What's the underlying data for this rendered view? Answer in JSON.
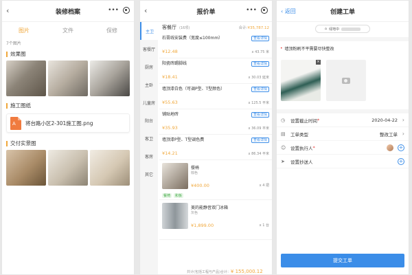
{
  "panel1": {
    "title": "装修档案",
    "tabs": [
      "图片",
      "文件",
      "保修"
    ],
    "count": "7个图片",
    "sections": {
      "effect": "效果图",
      "construction": "施工图纸",
      "delivery": "交付实景图"
    },
    "file": {
      "icon_label": "A",
      "name": "将台路小区2-301施工图.png"
    }
  },
  "panel2": {
    "title": "报价单",
    "sidebar": [
      "主卫",
      "客餐厅",
      "厨房",
      "主卧",
      "儿童房",
      "阳台",
      "客卫",
      "客房",
      "其它"
    ],
    "room": {
      "name": "客餐厅",
      "count": "(16项)",
      "total_label": "合计:",
      "total_value": "¥35,787.12"
    },
    "items": [
      {
        "name": "石膏线安装费（宽度≤100mm）",
        "price": "¥12.48",
        "qty": "x 43.75 米",
        "detail": "查看详情"
      },
      {
        "name": "阳瓷砖踢脚线",
        "price": "¥18.41",
        "qty": "x 30.03 延米",
        "detail": "查看详情"
      },
      {
        "name": "墙顶漆白色（可调P型、T型颜色）",
        "price": "¥55.63",
        "qty": "x 125.5 平米",
        "detail": "查看详情"
      },
      {
        "name": "铺贴地砖",
        "price": "¥35.93",
        "qty": "x 36.09 平米",
        "detail": "查看详情"
      },
      {
        "name": "墙顶漆P型、T型调色费",
        "price": "¥14.21",
        "qty": "x 86.34 平米",
        "detail": "查看详情"
      }
    ],
    "products": [
      {
        "name": "餐椅",
        "spec": "棕色",
        "price": "¥400.00",
        "qty": "x 4 把",
        "tags": [
          "餐椅",
          "和板"
        ]
      },
      {
        "name": "美的能静音双门冰箱",
        "spec": "灰色",
        "price": "¥1,899.00",
        "qty": "x 1 台",
        "tags": []
      }
    ],
    "footer": {
      "label": "共计(包括工程与产品)合计：",
      "value": "¥ 155,000.12"
    }
  },
  "panel3": {
    "title": "创建工单",
    "back": "返回",
    "pill_label": "绿地中",
    "description": "墙顶粉刷不平需要尽快整改",
    "rows": [
      {
        "label": "设置截止时间",
        "required": "*",
        "value": "2020-04-22",
        "icon": "clock-icon"
      },
      {
        "label": "工单类型",
        "required": "",
        "value": "整改工单",
        "icon": "doc-icon"
      },
      {
        "label": "设置执行人",
        "required": "*",
        "value": "",
        "icon": "user-icon"
      },
      {
        "label": "设置抄送人",
        "required": "",
        "value": "",
        "icon": "send-icon"
      }
    ],
    "submit": "提交工单"
  }
}
